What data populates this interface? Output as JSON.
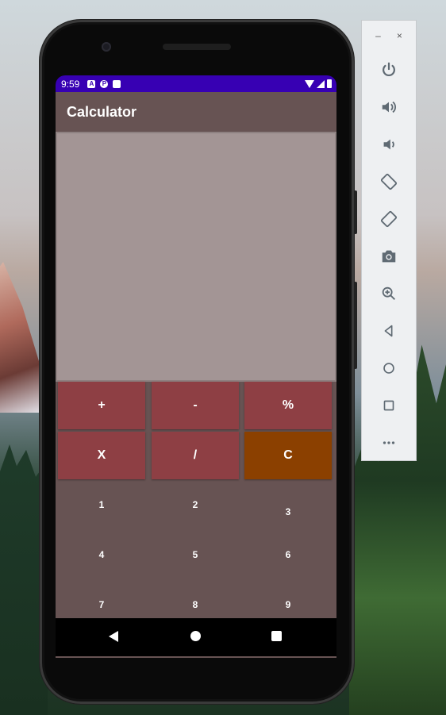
{
  "status_bar": {
    "time": "9:59",
    "icons_left": [
      "A",
      "P",
      "▮"
    ]
  },
  "app": {
    "title": "Calculator"
  },
  "display": {
    "value": ""
  },
  "operators": {
    "row1": [
      "+",
      "-",
      "%"
    ],
    "row2": [
      "X",
      "/",
      "C"
    ]
  },
  "digits": {
    "row1": [
      "1",
      "2",
      "3"
    ],
    "row2": [
      "4",
      "5",
      "6"
    ],
    "row3": [
      "7",
      "8",
      "9"
    ]
  },
  "emulator_panel": {
    "minimize": "–",
    "close": "×",
    "tools": [
      "power-icon",
      "volume-up-icon",
      "volume-down-icon",
      "rotate-left-icon",
      "rotate-right-icon",
      "camera-icon",
      "zoom-icon",
      "back-icon",
      "home-icon",
      "overview-icon",
      "more-icon"
    ]
  },
  "colors": {
    "status_bar": "#3700b3",
    "app_bar": "#675353",
    "display": "#a39595",
    "operator": "#8e3f44",
    "clear": "#8b4000"
  }
}
